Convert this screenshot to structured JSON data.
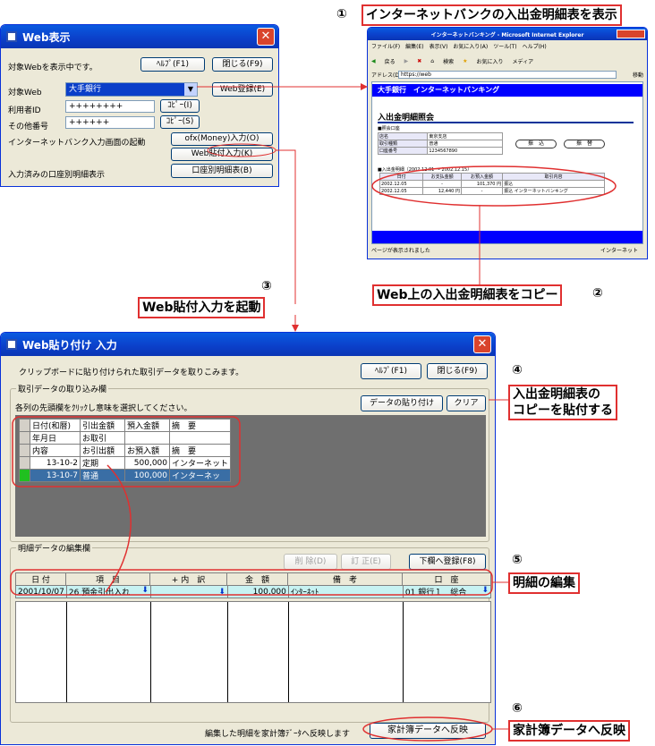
{
  "web_window": {
    "title": "Web表示",
    "status": "対象Webを表示中です。",
    "help_btn": "ﾍﾙﾌﾟ(F1)",
    "close_btn": "閉じる(F9)",
    "target_label": "対象Web",
    "target_value": "大手銀行",
    "register_btn": "Web登録(E)",
    "user_label": "利用者ID",
    "user_value": "++++++++",
    "copy1_btn": "ｺﾋﾟｰ(I)",
    "other_label": "その他番号",
    "other_value": "++++++",
    "copy2_btn": "ｺﾋﾟｰ(S)",
    "launch_label": "インターネットバンク入力画面の起動",
    "ofx_btn": "ofx(Money)入力(O)",
    "paste_btn": "Web貼付入力(K)",
    "detail_label": "入力済みの口座別明細表示",
    "detail_btn": "口座別明細表(B)"
  },
  "ie": {
    "title": "インターネットバンキング - Microsoft Internet Explorer",
    "menu": [
      "ファイル(F)",
      "編集(E)",
      "表示(V)",
      "お気に入り(A)",
      "ツール(T)",
      "ヘルプ(H)"
    ],
    "toolbar": [
      "戻る",
      "検索",
      "お気に入り",
      "メディア"
    ],
    "address_label": "アドレス(D)",
    "address": "https://web",
    "go": "移動",
    "bank_header": "大手銀行　インターネットバンキング",
    "page_title": "入出金明細照会",
    "section": "■照会口座",
    "acct_rows": [
      [
        "店名",
        "東京支店"
      ],
      [
        "取引種類",
        "普通"
      ],
      [
        "口座番号",
        "1234567890"
      ]
    ],
    "btn_transfer": "振　込",
    "btn_swap": "振　替",
    "period": "■入出金明細（2002.12.01 ～ 2002.12.15）",
    "tbl_head": [
      "日付",
      "お支払金額",
      "お預入金額",
      "取引内容"
    ],
    "tbl_rows": [
      [
        "2002.12.05",
        "-",
        "101,370 円",
        "振込"
      ],
      [
        "2002.12.05",
        "12,440 円",
        "-",
        "振込 インターネットバンキング"
      ]
    ],
    "status_left": "ページが表示されました",
    "status_right": "インターネット"
  },
  "paste_window": {
    "title": "Web貼り付け 入力",
    "info": "クリップボードに貼り付けられた取引データを取りこみます。",
    "help_btn": "ﾍﾙﾌﾟ(F1)",
    "close_btn": "閉じる(F9)",
    "grp1": "取引データの取り込み欄",
    "grp1_hint": "各列の先頭欄をｸﾘｯｸし意味を選択してください。",
    "paste_data_btn": "データの貼り付け",
    "clear_btn": "クリア",
    "grid": [
      [
        "日付(和暦)",
        "引出金額",
        "預入金額",
        "摘　要"
      ],
      [
        "年月日",
        "お取引",
        "",
        ""
      ],
      [
        "内容",
        "お引出額",
        "お預入額",
        "摘　要"
      ],
      [
        "13-10-2",
        "定期",
        "500,000",
        "インターネット"
      ],
      [
        "13-10-7",
        "普通",
        "100,000",
        "インターネッ"
      ]
    ],
    "grp2": "明細データの編集欄",
    "del_btn": "削 除(D)",
    "fix_btn": "訂 正(E)",
    "register_btn": "下欄へ登録(F8)",
    "edit_head": [
      "日 付",
      "項　目",
      "+ 内　訳",
      "金　額",
      "備　考",
      "口　座"
    ],
    "edit_row": [
      "2001/10/07",
      "26 預金引出入れ",
      "",
      "100,000",
      "ｲﾝﾀｰﾈｯﾄ",
      "01 銀行１　総合"
    ],
    "footer_text": "編集した明細を家計簿ﾃﾞｰﾀへ反映します",
    "reflect_btn": "家計簿データへ反映"
  },
  "callouts": {
    "c1": {
      "num": "①",
      "text": "インターネットバンクの入出金明細表を表示"
    },
    "c2": {
      "num": "②",
      "text": "Web上の入出金明細表をコピー"
    },
    "c3": {
      "num": "③",
      "text": "Web貼付入力を起動"
    },
    "c4": {
      "num": "④",
      "text1": "入出金明細表の",
      "text2": "コピーを貼付する"
    },
    "c5": {
      "num": "⑤",
      "text": "明細の編集"
    },
    "c6": {
      "num": "⑥",
      "text": "家計簿データへ反映"
    }
  },
  "colors": {
    "accent_red": "#e03030",
    "xp_blue": "#0a5ae0",
    "grid_dark": "#6f6f6f",
    "bank_blue": "#0000ff"
  }
}
